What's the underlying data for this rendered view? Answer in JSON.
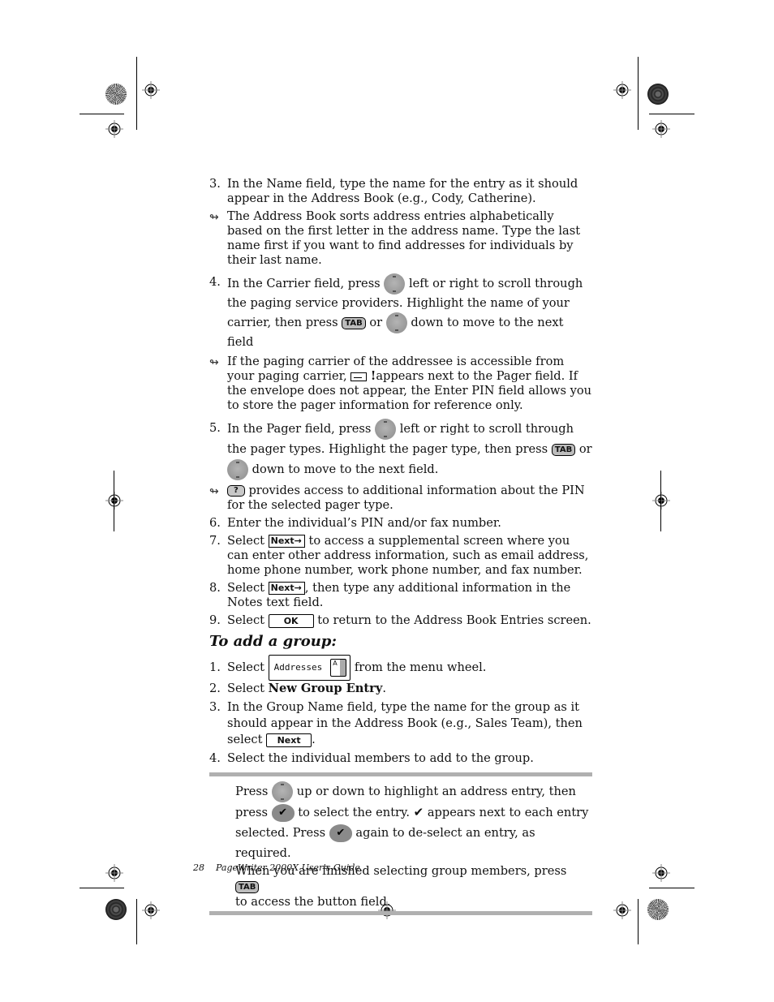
{
  "steps_part1": [
    {
      "num": "3.",
      "text": "In the Name field, type the name for the entry as it should appear in the Address Book (e.g., Cody, Catherine)."
    },
    {
      "note": "The Address Book sorts address entries alphabetically based on the first letter in the address name. Type the last name first if you want to find addresses for individuals by their last name."
    }
  ],
  "step4": {
    "num": "4.",
    "a": "In the Carrier field, press",
    "b": "left or right to scroll through the paging service providers. Highlight the name of your carrier, then press",
    "c": "or",
    "d": "down to move to the next field"
  },
  "note_carrier": {
    "a": "If the paging carrier of the addressee is accessible from your paging carrier,",
    "excl": "!",
    "b": "appears next to the Pager field. If the envelope does not appear, the Enter PIN field allows you to store the pager information for reference only."
  },
  "step5": {
    "num": "5.",
    "a": "In the Pager field, press",
    "b": "left or right to scroll through the pager types. Highlight the pager type, then press",
    "c": "or",
    "d": "down to move to the next field."
  },
  "note_help": {
    "text": "provides access to additional information about the PIN for the selected pager type."
  },
  "step6": {
    "num": "6.",
    "text": "Enter the individual’s PIN and/or fax number."
  },
  "step7": {
    "num": "7.",
    "a": "Select",
    "b": "to access a supplemental screen where you can enter other address information, such as email address, home phone number, work phone number, and fax number."
  },
  "step8": {
    "num": "8.",
    "a": "Select",
    "b": ", then type any additional information in the Notes text field."
  },
  "step9": {
    "num": "9.",
    "a": "Select",
    "b": "to return to the Address Book Entries screen."
  },
  "section_title": "To add a group:",
  "group_steps": {
    "s1": {
      "num": "1.",
      "a": "Select",
      "b": "from the menu wheel."
    },
    "s2": {
      "num": "2.",
      "a": "Select",
      "bold": "New Group Entry",
      "b": "."
    },
    "s3": {
      "num": "3.",
      "a": "In the Group Name field, type the name for the group as it should appear in the Address Book (e.g., Sales Team), then select",
      "b": "."
    },
    "s4": {
      "num": "4.",
      "text": "Select the individual members to add to the group."
    }
  },
  "callout": {
    "l1a": "Press",
    "l1b": "up or down to highlight an address entry, then",
    "l2a": "press",
    "l2b": "to select the entry.",
    "l2c": "appears next to each entry",
    "l3a": "selected. Press",
    "l3b": "again to de-select an entry, as required.",
    "l4a": "When you are finished selecting group members, press",
    "l5": "to access the button field."
  },
  "buttons": {
    "tab": "TAB",
    "help": "?",
    "next_arrow": "Next→",
    "ok": "OK",
    "next": "Next",
    "addresses": "Addresses",
    "book_letter": "A",
    "check": "✔"
  },
  "icons": {
    "note": "↬",
    "nav_pad": "navigation-pad-icon",
    "check_button": "check-button-icon",
    "envelope": "envelope-icon"
  },
  "footer": {
    "page_number": "28",
    "title": "PageWriter 2000X User’s Guide"
  }
}
